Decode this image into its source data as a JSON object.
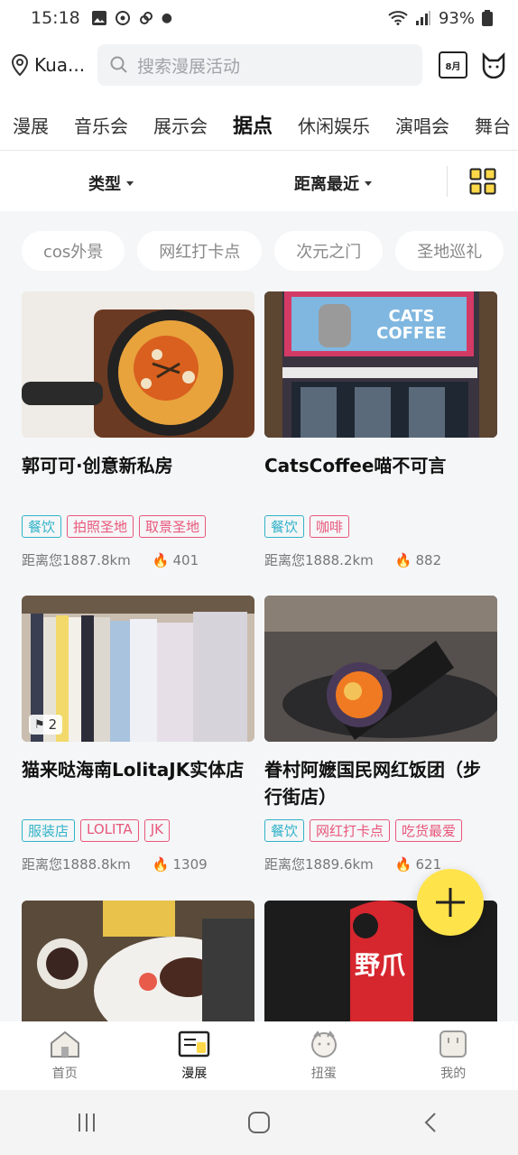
{
  "status": {
    "time": "15:18",
    "battery": "93%"
  },
  "header": {
    "location": "Kua...",
    "search_placeholder": "搜索漫展活动",
    "calendar_label": "8月"
  },
  "categories": [
    "漫展",
    "音乐会",
    "展示会",
    "据点",
    "休闲娱乐",
    "演唱会",
    "舞台"
  ],
  "active_category": "据点",
  "filters": {
    "type_label": "类型",
    "sort_label": "距离最近"
  },
  "chips": [
    "cos外景",
    "网红打卡点",
    "次元之门",
    "圣地巡礼"
  ],
  "cards": [
    {
      "title": "郭可可·创意新私房",
      "tags": [
        {
          "text": "餐饮",
          "color": "blue"
        },
        {
          "text": "拍照圣地",
          "color": "pink"
        },
        {
          "text": "取景圣地",
          "color": "pink"
        }
      ],
      "distance": "距离您1887.8km",
      "heat": "401",
      "image": "food-skillet"
    },
    {
      "title": "CatsCoffee喵不可言",
      "tags": [
        {
          "text": "餐饮",
          "color": "blue"
        },
        {
          "text": "咖啡",
          "color": "pink"
        }
      ],
      "distance": "距离您1888.2km",
      "heat": "882",
      "image": "cafe-storefront",
      "sign_text": "CATS COFFEE"
    },
    {
      "title": "猫来哒海南LolitaJK实体店",
      "tags": [
        {
          "text": "服装店",
          "color": "blue"
        },
        {
          "text": "LOLITA",
          "color": "pink"
        },
        {
          "text": "JK",
          "color": "pink"
        }
      ],
      "distance": "距离您1888.8km",
      "heat": "1309",
      "image": "clothing-rack",
      "badge": "2"
    },
    {
      "title": "眷村阿嬷国民网红饭团（步行街店）",
      "tags": [
        {
          "text": "餐饮",
          "color": "blue"
        },
        {
          "text": "网红打卡点",
          "color": "pink"
        },
        {
          "text": "吃货最爱",
          "color": "pink"
        }
      ],
      "distance": "距离您1889.6km",
      "heat": "621",
      "image": "rice-roll"
    },
    {
      "title": "",
      "image": "steak-plate"
    },
    {
      "title": "",
      "image": "red-logo",
      "logo_text": "野爪"
    }
  ],
  "tabs": [
    {
      "label": "首页",
      "icon": "home-icon"
    },
    {
      "label": "漫展",
      "icon": "expo-icon"
    },
    {
      "label": "扭蛋",
      "icon": "gacha-icon"
    },
    {
      "label": "我的",
      "icon": "profile-icon"
    }
  ],
  "active_tab": "漫展",
  "colors": {
    "accent": "#ffe34a",
    "tag_blue": "#31b3c9",
    "tag_pink": "#e8577b"
  }
}
